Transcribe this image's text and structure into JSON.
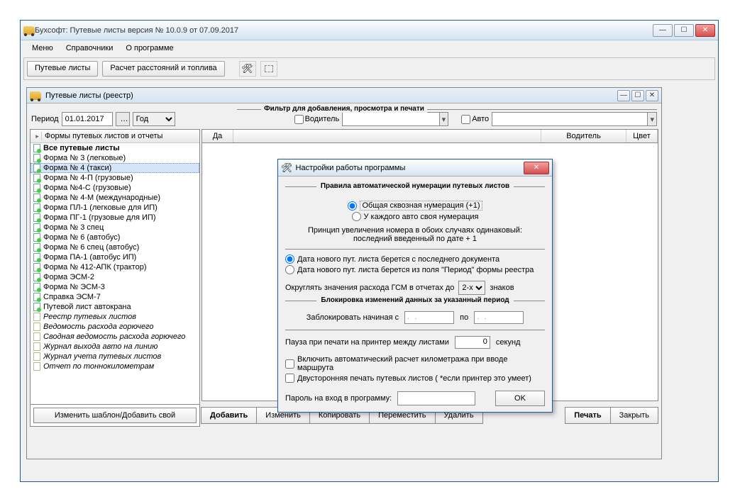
{
  "main_window": {
    "title": "Бухсофт: Путевые листы версия № 10.0.9 от 07.09.2017"
  },
  "menu": {
    "m1": "Меню",
    "m2": "Справочники",
    "m3": "О программе"
  },
  "toolbar": {
    "b1": "Путевые листы",
    "b2": "Расчет расстояний и топлива"
  },
  "mdi": {
    "title": "Путевые листы (реестр)",
    "filter_title": "Фильтр для добавления, просмотра и печати",
    "period_label": "Период",
    "period_value": "01.01.2017",
    "period_unit": "Год",
    "driver_label": "Водитель",
    "auto_label": "Авто"
  },
  "tree": {
    "header": "Формы путевых листов и отчеты",
    "items": [
      {
        "t": "Все путевые листы",
        "bold": true,
        "doc": true
      },
      {
        "t": "Форма № 3 (легковые)",
        "doc": true
      },
      {
        "t": "Форма № 4 (такси)",
        "doc": true,
        "sel": true
      },
      {
        "t": "Форма № 4-П (грузовые)",
        "doc": true
      },
      {
        "t": "Форма №4-С (грузовые)",
        "doc": true
      },
      {
        "t": "Форма № 4-М (международные)",
        "doc": true
      },
      {
        "t": "Форма ПЛ-1 (легковые для ИП)",
        "doc": true
      },
      {
        "t": "Форма ПГ-1 (грузовые для ИП)",
        "doc": true
      },
      {
        "t": "Форма № 3 спец",
        "doc": true
      },
      {
        "t": "Форма № 6 (автобус)",
        "doc": true
      },
      {
        "t": "Форма № 6 спец (автобус)",
        "doc": true
      },
      {
        "t": "Форма ПА-1 (автобус ИП)",
        "doc": true
      },
      {
        "t": "Форма № 412-АПК (трактор)",
        "doc": true
      },
      {
        "t": "Форма ЭСМ-2",
        "doc": true
      },
      {
        "t": "Форма № ЭСМ-3",
        "doc": true
      },
      {
        "t": "Справка ЭСМ-7",
        "doc": true
      },
      {
        "t": "Путевой лист автокрана",
        "doc": true
      },
      {
        "t": "Реестр путевых листов",
        "italic": true
      },
      {
        "t": "Ведомость расхода горючего",
        "italic": true
      },
      {
        "t": "Сводная ведомость расхода горючего",
        "italic": true
      },
      {
        "t": "Журнал выхода авто на линию",
        "italic": true
      },
      {
        "t": "Журнал учета путевых листов",
        "italic": true
      },
      {
        "t": "Отчет по тоннокилометрам",
        "italic": true
      }
    ],
    "footer_btn": "Изменить шаблон/Добавить свой"
  },
  "grid": {
    "c1": "Да",
    "c2": "Водитель",
    "c3": "Цвет"
  },
  "buttons": {
    "add": "Добавить",
    "edit": "Изменить",
    "copy": "Копировать",
    "move": "Переместить",
    "del": "Удалить",
    "print": "Печать",
    "close": "Закрыть"
  },
  "modal": {
    "title": "Настройки работы программы",
    "sec1": "Правила автоматической нумерации путевых листов",
    "r1": "Общая сквозная нумерация (+1)",
    "r2": "У каждого авто своя нумерация",
    "note1": "Принцип увеличения номера в обоих случаях одинаковый:",
    "note2": "последний введенный по дате + 1",
    "r3": "Дата нового пут. листа берется с последнего документа",
    "r4": "Дата нового пут. листа берется из поля \"Период\" формы реестра",
    "round_l": "Округлять значения расхода ГСМ в отчетах до",
    "round_v": "2-х",
    "round_r": "знаков",
    "sec2": "Блокировка изменений данных за указанный период",
    "block_l": "Заблокировать начиная с",
    "block_m": "по",
    "date_empty": ". .",
    "pause_l": "Пауза при печати на принтер между листами",
    "pause_v": "0",
    "pause_r": "секунд",
    "cb1": "Включить автоматический расчет километража при вводе маршрута",
    "cb2": "Двусторонняя печать путевых листов ( *если принтер это умеет)",
    "pw_l": "Пароль на вход в программу:",
    "ok": "OK"
  }
}
